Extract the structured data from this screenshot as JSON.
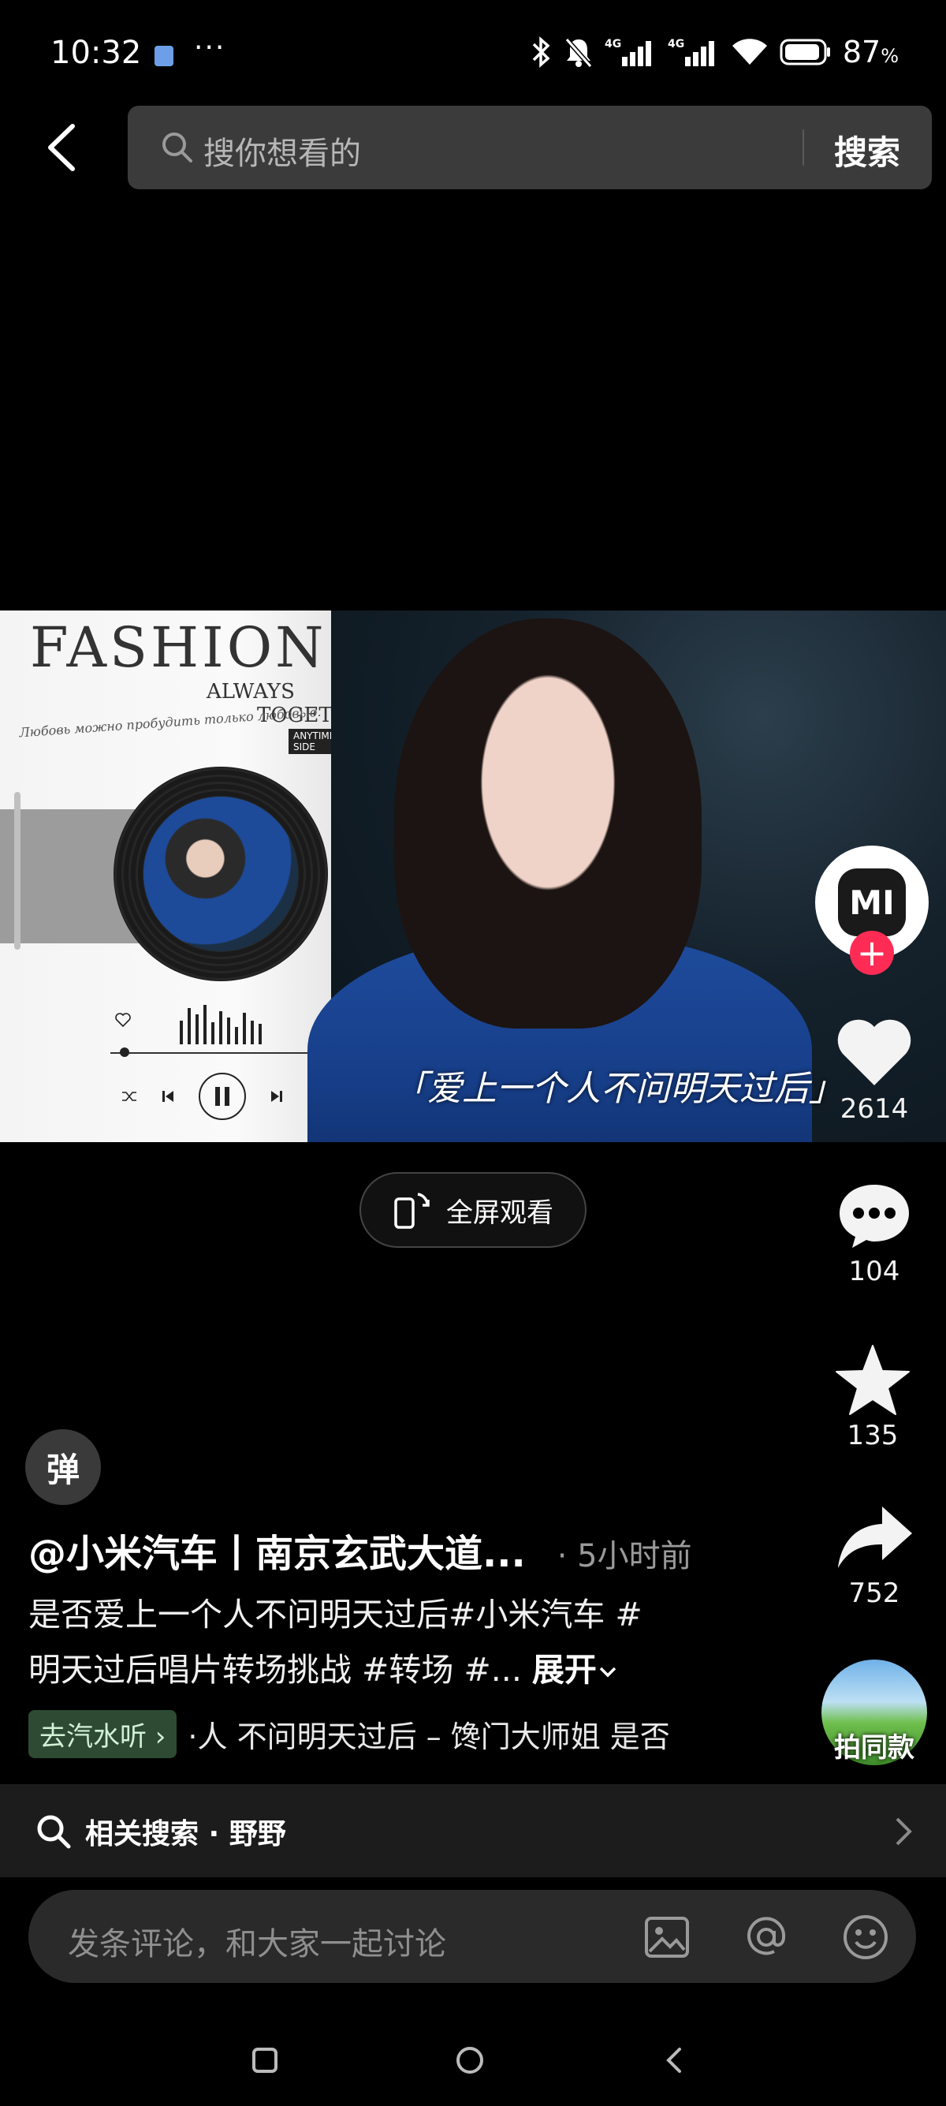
{
  "status_bar": {
    "time": "10:32",
    "more": "···",
    "battery": "87",
    "battery_unit": "%",
    "network": "4G"
  },
  "header": {
    "search_placeholder": "搜你想看的",
    "search_button": "搜索"
  },
  "video": {
    "poster_title": "FASHION",
    "poster_always": "ALWAYS",
    "poster_together": "TOGETHER",
    "poster_tag": "ANYTIME YOUR SIDE",
    "poster_script": "Любовь можно пробудить только любовью.",
    "subtitle": "「爱上一个人不问明天过后」",
    "fullscreen_label": "全屏观看"
  },
  "rail": {
    "likes": "2614",
    "comments": "104",
    "favorites": "135",
    "shares": "752",
    "same_style": "拍同款",
    "avatar_logo": "MI",
    "follow": "+"
  },
  "post": {
    "danmu": "弹",
    "author": "@小米汽车丨南京玄武大道...",
    "time": "· 5小时前",
    "desc_line1": "是否爱上一个人不问明天过后#小米汽车 #",
    "desc_line2": "明天过后唱片转场挑战 #转场 #...",
    "expand": "展开",
    "music_chip": "去汽水听 ›",
    "music_text": "·人 不问明天过后 – 馋门大师姐    是否"
  },
  "related": {
    "label": "相关搜索 · 野野"
  },
  "comment": {
    "placeholder": "发条评论，和大家一起讨论"
  },
  "colors": {
    "background": "#000000",
    "search_bg": "#3b3b3b",
    "follow_red": "#fe2c55",
    "music_chip_bg": "#2e4a33"
  }
}
